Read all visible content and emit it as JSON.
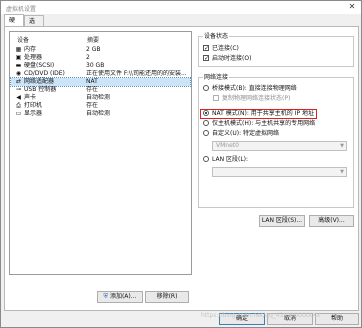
{
  "window": {
    "title": "虚拟机设置"
  },
  "tabs": [
    {
      "label": "硬件"
    },
    {
      "label": "选项"
    }
  ],
  "device_list": {
    "header_device": "设备",
    "header_summary": "摘要",
    "rows": [
      {
        "icon": "memory-icon",
        "glyph": "▦",
        "name": "内存",
        "summary": "2 GB"
      },
      {
        "icon": "cpu-icon",
        "glyph": "▣",
        "name": "处理器",
        "summary": "2"
      },
      {
        "icon": "disk-icon",
        "glyph": "▬",
        "name": "硬盘(SCSI)",
        "summary": "30 GB"
      },
      {
        "icon": "cd-icon",
        "glyph": "◉",
        "name": "CD/DVD (IDE)",
        "summary": "正在使用文件 F:\\\\司能还用的的安装..."
      },
      {
        "icon": "network-icon",
        "glyph": "⇄",
        "name": "网络适配器",
        "summary": "NAT"
      },
      {
        "icon": "usb-icon",
        "glyph": "⊸",
        "name": "USB 控制器",
        "summary": "存在"
      },
      {
        "icon": "sound-icon",
        "glyph": "◀",
        "name": "声卡",
        "summary": "自动检测"
      },
      {
        "icon": "printer-icon",
        "glyph": "⎙",
        "name": "打印机",
        "summary": "存在"
      },
      {
        "icon": "display-icon",
        "glyph": "▭",
        "name": "显示器",
        "summary": "自动检测"
      }
    ],
    "selected_index": 4
  },
  "buttons": {
    "add": "添加(A)...",
    "remove": "移除(R)",
    "lan_segments": "LAN 区段(S)...",
    "advanced": "高级(V)...",
    "ok": "确定",
    "cancel": "取消",
    "help": "帮助"
  },
  "device_status": {
    "legend": "设备状态",
    "connected": "已连接(C)",
    "connect_on_power": "启动时连接(O)"
  },
  "network_connection": {
    "legend": "网络连接",
    "bridged": "桥接模式(B): 直接连接物理网络",
    "replicate": "复制物理网络连接状态(P)",
    "nat": "NAT 模式(N): 用于共享主机的 IP 地址",
    "host_only": "仅主机模式(H): 与主机共享的专用网络",
    "custom": "自定义(U): 特定虚拟网络",
    "custom_select": "VMnet0",
    "lan_segment": "LAN 区段(L):",
    "lan_select": ""
  },
  "watermark": "https://blog.csdn.net/qq_43XXXXXXXXX"
}
